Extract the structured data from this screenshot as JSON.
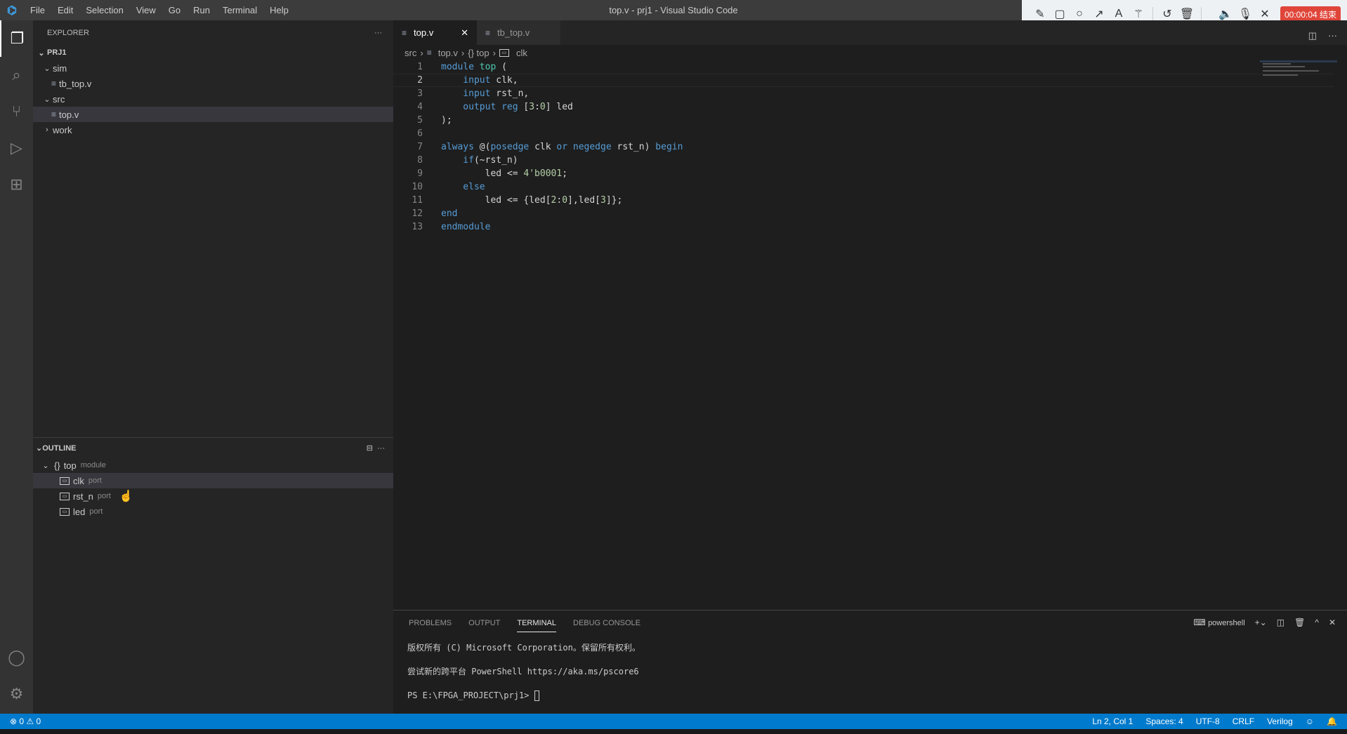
{
  "titlebar": {
    "menus": [
      "File",
      "Edit",
      "Selection",
      "View",
      "Go",
      "Run",
      "Terminal",
      "Help"
    ],
    "title": "top.v - prj1 - Visual Studio Code"
  },
  "recorder": {
    "tools": [
      "pencil",
      "rectangle",
      "circle",
      "arrow",
      "text",
      "magic-wand",
      "undo",
      "trash",
      "speaker",
      "microphone",
      "close"
    ],
    "timer": "00:00:04 结束"
  },
  "explorer": {
    "title": "EXPLORER",
    "more": "···",
    "project": "PRJ1",
    "items": [
      {
        "label": "sim",
        "type": "folder",
        "open": true
      },
      {
        "label": "tb_top.v",
        "type": "file"
      },
      {
        "label": "src",
        "type": "folder",
        "open": true
      },
      {
        "label": "top.v",
        "type": "file",
        "selected": true
      },
      {
        "label": "work",
        "type": "folder",
        "open": false
      }
    ]
  },
  "outline": {
    "title": "OUTLINE",
    "module": {
      "name": "top",
      "kind": "module"
    },
    "ports": [
      {
        "name": "clk",
        "kind": "port"
      },
      {
        "name": "rst_n",
        "kind": "port"
      },
      {
        "name": "led",
        "kind": "port"
      }
    ]
  },
  "tabs": [
    {
      "label": "top.v",
      "active": true
    },
    {
      "label": "tb_top.v",
      "active": false
    }
  ],
  "breadcrumb": [
    "src",
    "top.v",
    "{} top",
    "clk"
  ],
  "code": {
    "current_line": 2,
    "lines": [
      [
        [
          "k",
          "module"
        ],
        [
          "",
          "",
          " "
        ],
        [
          "t",
          "top"
        ],
        [
          "",
          "",
          " ("
        ]
      ],
      [
        [
          "",
          ""
        ],
        [
          "k",
          "    input"
        ],
        [
          "",
          " clk,"
        ]
      ],
      [
        [
          "k",
          "    input"
        ],
        [
          "",
          " rst_n,"
        ]
      ],
      [
        [
          "k",
          "    output reg"
        ],
        [
          "",
          " ["
        ],
        [
          "n",
          "3"
        ],
        [
          "",
          ":"
        ],
        [
          "n",
          "0"
        ],
        [
          "",
          "] led"
        ]
      ],
      [
        [
          "",
          ");"
        ]
      ],
      [
        [
          "",
          ""
        ]
      ],
      [
        [
          "k",
          "always"
        ],
        [
          "",
          " @("
        ],
        [
          "k",
          "posedge"
        ],
        [
          "",
          " clk "
        ],
        [
          "k",
          "or"
        ],
        [
          "",
          " "
        ],
        [
          "k",
          "negedge"
        ],
        [
          "",
          " rst_n) "
        ],
        [
          "k",
          "begin"
        ]
      ],
      [
        [
          "k",
          "    if"
        ],
        [
          "",
          "(~rst_n)"
        ]
      ],
      [
        [
          "",
          "        led <= "
        ],
        [
          "n",
          "4'b0001"
        ],
        [
          "",
          ";"
        ]
      ],
      [
        [
          "k",
          "    else"
        ]
      ],
      [
        [
          "",
          "        led <= {led["
        ],
        [
          "n",
          "2"
        ],
        [
          "",
          ":"
        ],
        [
          "n",
          "0"
        ],
        [
          "",
          "],led["
        ],
        [
          "n",
          "3"
        ],
        [
          "",
          "]};"
        ]
      ],
      [
        [
          "k",
          "end"
        ]
      ],
      [
        [
          "k",
          "endmodule"
        ]
      ]
    ]
  },
  "panel": {
    "tabs": [
      "PROBLEMS",
      "OUTPUT",
      "TERMINAL",
      "DEBUG CONSOLE"
    ],
    "active": "TERMINAL",
    "shell": "powershell",
    "terminal": [
      "版权所有 (C) Microsoft Corporation。保留所有权利。",
      "尝试新的跨平台 PowerShell https://aka.ms/pscore6",
      "PS E:\\FPGA_PROJECT\\prj1> "
    ]
  },
  "status": {
    "errors": "0",
    "warnings": "0",
    "position": "Ln 2, Col 1",
    "spaces": "Spaces: 4",
    "encoding": "UTF-8",
    "eol": "CRLF",
    "language": "Verilog"
  }
}
